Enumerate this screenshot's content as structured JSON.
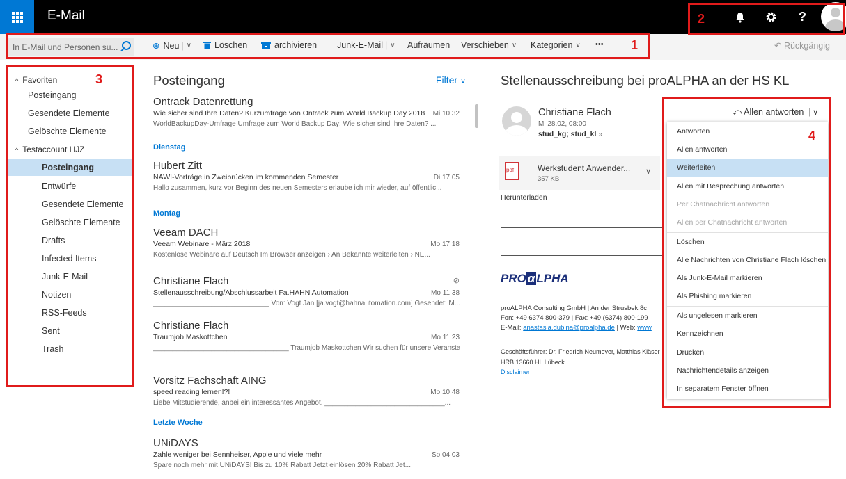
{
  "app": {
    "title": "E-Mail"
  },
  "top_icons": [
    "bell-icon",
    "gear-icon",
    "help-icon",
    "avatar"
  ],
  "top_help_glyph": "?",
  "search": {
    "placeholder": "In E-Mail und Personen su..."
  },
  "toolbar": {
    "neu": "Neu",
    "loeschen": "Löschen",
    "archivieren": "archivieren",
    "junk": "Junk-E-Mail",
    "aufraeumen": "Aufräumen",
    "verschieben": "Verschieben",
    "kategorien": "Kategorien",
    "more": "•••",
    "undo": "Rückgängig"
  },
  "annotations": {
    "n1": "1",
    "n2": "2",
    "n3": "3",
    "n4": "4"
  },
  "sidebar": {
    "favorites_header": "Favoriten",
    "favorites": [
      "Posteingang",
      "Gesendete Elemente",
      "Gelöschte Elemente"
    ],
    "account_header": "Testaccount HJZ",
    "account_folders": [
      "Posteingang",
      "Entwürfe",
      "Gesendete Elemente",
      "Gelöschte Elemente",
      "Drafts",
      "Infected Items",
      "Junk-E-Mail",
      "Notizen",
      "RSS-Feeds",
      "Sent",
      "Trash"
    ],
    "selected": "Posteingang"
  },
  "list": {
    "title": "Posteingang",
    "filter": "Filter",
    "groups": {
      "dienstag": "Dienstag",
      "montag": "Montag",
      "letzte_woche": "Letzte Woche"
    },
    "messages": [
      {
        "sender": "Ontrack Datenrettung",
        "subject": "Wie sicher sind Ihre Daten? Kurzumfrage von Ontrack zum World Backup Day 2018",
        "time": "Mi 10:32",
        "preview": "WorldBackupDay-Umfrage   Umfrage zum World Backup Day: Wie sicher sind Ihre Daten?  ..."
      },
      {
        "sender": "Hubert Zitt",
        "subject": "NAWI-Vorträge in Zweibrücken im kommenden Semester",
        "time": "Di 17:05",
        "preview": "Hallo zusammen,  kurz vor Beginn des neuen Semesters erlaube ich mir wieder, auf öffentlic..."
      },
      {
        "sender": "Veeam DACH",
        "subject": "Veeam Webinare - März 2018",
        "time": "Mo 17:18",
        "preview": "Kostenlose Webinare auf Deutsch  Im Browser anzeigen ›   An Bekannte weiterleiten ›    NE..."
      },
      {
        "sender": "Christiane Flach",
        "subject": "Stellenausschreibung/Abschlussarbeit Fa.HAHN Automation",
        "time": "Mo 11:38",
        "preview": "______________________________ Von: Vogt Jan [ja.vogt@hahnautomation.com] Gesendet: M..."
      },
      {
        "sender": "Christiane Flach",
        "subject": "Traumjob Maskottchen",
        "time": "Mo 11:23",
        "preview": "___________________________________   Traumjob Maskottchen  Wir suchen für unsere Veranstaltun..."
      },
      {
        "sender": "Vorsitz Fachschaft AING",
        "subject": "speed reading lernen!?!",
        "time": "Mo 10:48",
        "preview": "Liebe Mitstudierende,  anbei ein interessantes Angebot.  _______________________________..."
      },
      {
        "sender": "UNiDAYS",
        "subject": "Zahle weniger bei Sennheiser, Apple und viele mehr",
        "time": "So 04.03",
        "preview": "Spare noch mehr mit UNiDAYS!      Bis zu 10% Rabatt  Jetzt einlösen      20% Rabatt  Jet..."
      }
    ]
  },
  "reading": {
    "title": "Stellenausschreibung bei proALPHA an der HS KL",
    "sender": "Christiane Flach",
    "date": "Mi 28.02, 08:00",
    "recipients": "stud_kg; stud_kl",
    "attachment": {
      "name": "Werkstudent Anwender...",
      "size": "357 KB",
      "icon_text": "pdf"
    },
    "download": "Herunterladen",
    "logo": {
      "pre": "PRO",
      "alpha": "α",
      "post": "LPHA"
    },
    "signature": {
      "line1": "proALPHA Consulting GmbH | An der Strusbek 8c",
      "line2": "Fon: +49 6374 800-379 | Fax: +49 (6374) 800-199",
      "line3_prefix": "E-Mail: ",
      "email": "anastasia.dubina@proalpha.de",
      "line3_mid": " | Web: ",
      "web": "www",
      "line4": "Geschäftsführer: Dr. Friedrich Neumeyer, Matthias Kläser",
      "line5": "HRB 13660 HL Lübeck",
      "disclaimer": "Disclaimer"
    },
    "reply_all": "Allen antworten"
  },
  "context_menu": {
    "items": [
      {
        "label": "Antworten",
        "state": "normal"
      },
      {
        "label": "Allen antworten",
        "state": "normal"
      },
      {
        "label": "Weiterleiten",
        "state": "highlighted"
      },
      {
        "label": "Allen mit Besprechung antworten",
        "state": "normal"
      },
      {
        "label": "Per Chatnachricht antworten",
        "state": "disabled"
      },
      {
        "label": "Allen per Chatnachricht antworten",
        "state": "disabled"
      },
      {
        "label": "Löschen",
        "state": "normal"
      },
      {
        "label": "Alle Nachrichten von Christiane Flach löschen",
        "state": "normal"
      },
      {
        "label": "Als Junk-E-Mail markieren",
        "state": "normal"
      },
      {
        "label": "Als Phishing markieren",
        "state": "normal"
      },
      {
        "label": "Als ungelesen markieren",
        "state": "normal"
      },
      {
        "label": "Kennzeichnen",
        "state": "normal"
      },
      {
        "label": "Drucken",
        "state": "normal"
      },
      {
        "label": "Nachrichtendetails anzeigen",
        "state": "normal"
      },
      {
        "label": "In separatem Fenster öffnen",
        "state": "normal"
      }
    ]
  },
  "colors": {
    "accent": "#0078d4",
    "annotation": "#e01b1b",
    "selected_bg": "#c7e0f4",
    "topbar": "#000000"
  }
}
